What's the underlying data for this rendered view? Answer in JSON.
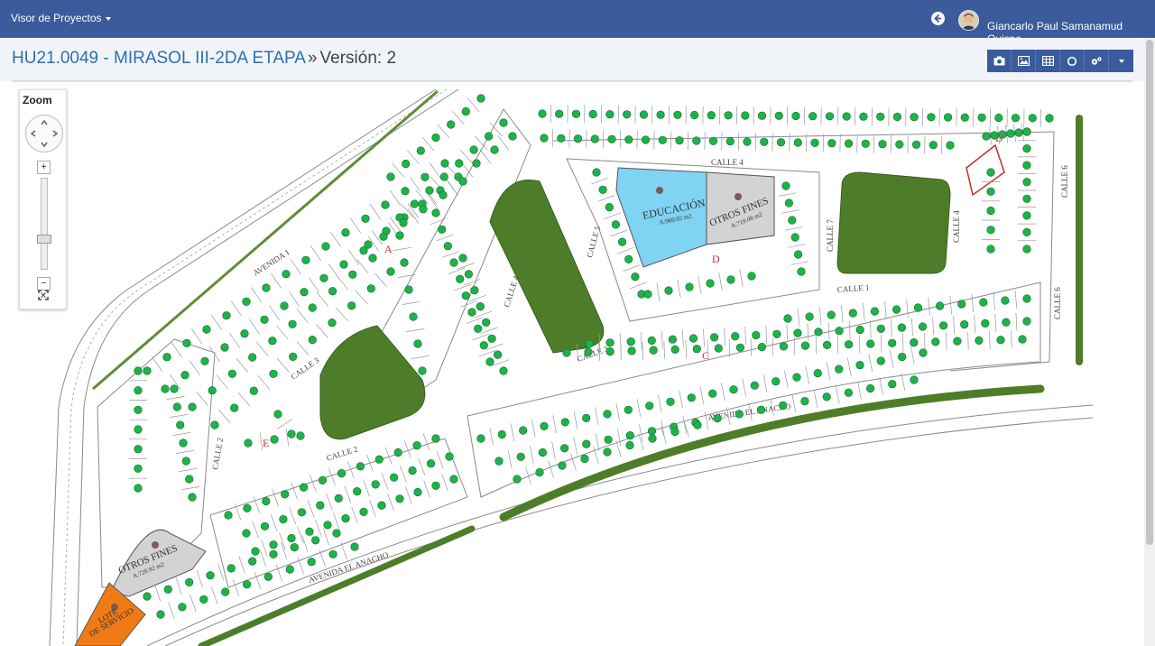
{
  "navbar": {
    "brand_label": "Visor de Proyectos",
    "user_name": "Giancarlo Paul Samanamud Quispe",
    "color": "#3b5b9c"
  },
  "page": {
    "project_code": "HU21.0049 - MIRASOL III-2DA ETAPA",
    "separator": "»",
    "version_label": "Versión: 2"
  },
  "toolbar": {
    "buttons": [
      "camera-icon",
      "image-icon",
      "table-icon",
      "circle-icon",
      "settings-icon",
      "caret-down-icon"
    ]
  },
  "zoom": {
    "title": "Zoom",
    "plus": "+",
    "minus": "−"
  },
  "map": {
    "streets": {
      "avenida_1": "AVENIDA 1",
      "avenida_el_anacho_1": "AVENIDA EL ANACHO",
      "avenida_el_anacho_2": "AVENIDA EL ANACHO",
      "calle_1": "CALLE 1",
      "calle_2a": "CALLE 2",
      "calle_2b": "CALLE 2",
      "calle_3a": "CALLE 3",
      "calle_3b": "CALLE 3",
      "calle_4a": "CALLE 4",
      "calle_4b": "CALLE 4",
      "calle_4c": "CALLE 4",
      "calle_5": "CALLE 5",
      "calle_6a": "CALLE 6",
      "calle_6b": "CALLE 6",
      "calle_7": "CALLE 7"
    },
    "areas": {
      "educacion_label": "EDUCACIÓN",
      "educacion_area": "A:960.02 m2",
      "otros_fines_1_label": "OTROS FINES",
      "otros_fines_1_area": "A:719.08 m2",
      "otros_fines_2_label": "OTROS FINES",
      "otros_fines_2_area": "A:720.92 m2",
      "lote_servicio_1": "LOTE",
      "lote_servicio_2": "DE SERVICIO"
    },
    "block_letters": {
      "a": "A",
      "b": "B",
      "c": "C",
      "d": "D",
      "e": "E"
    },
    "colors": {
      "park": "#4e7d2a",
      "education": "#7fd3f3",
      "other_uses": "#d3d3d3",
      "service": "#f07b16",
      "lot_marker": "#1fb24a",
      "selected_outline": "#d22b2b"
    }
  }
}
